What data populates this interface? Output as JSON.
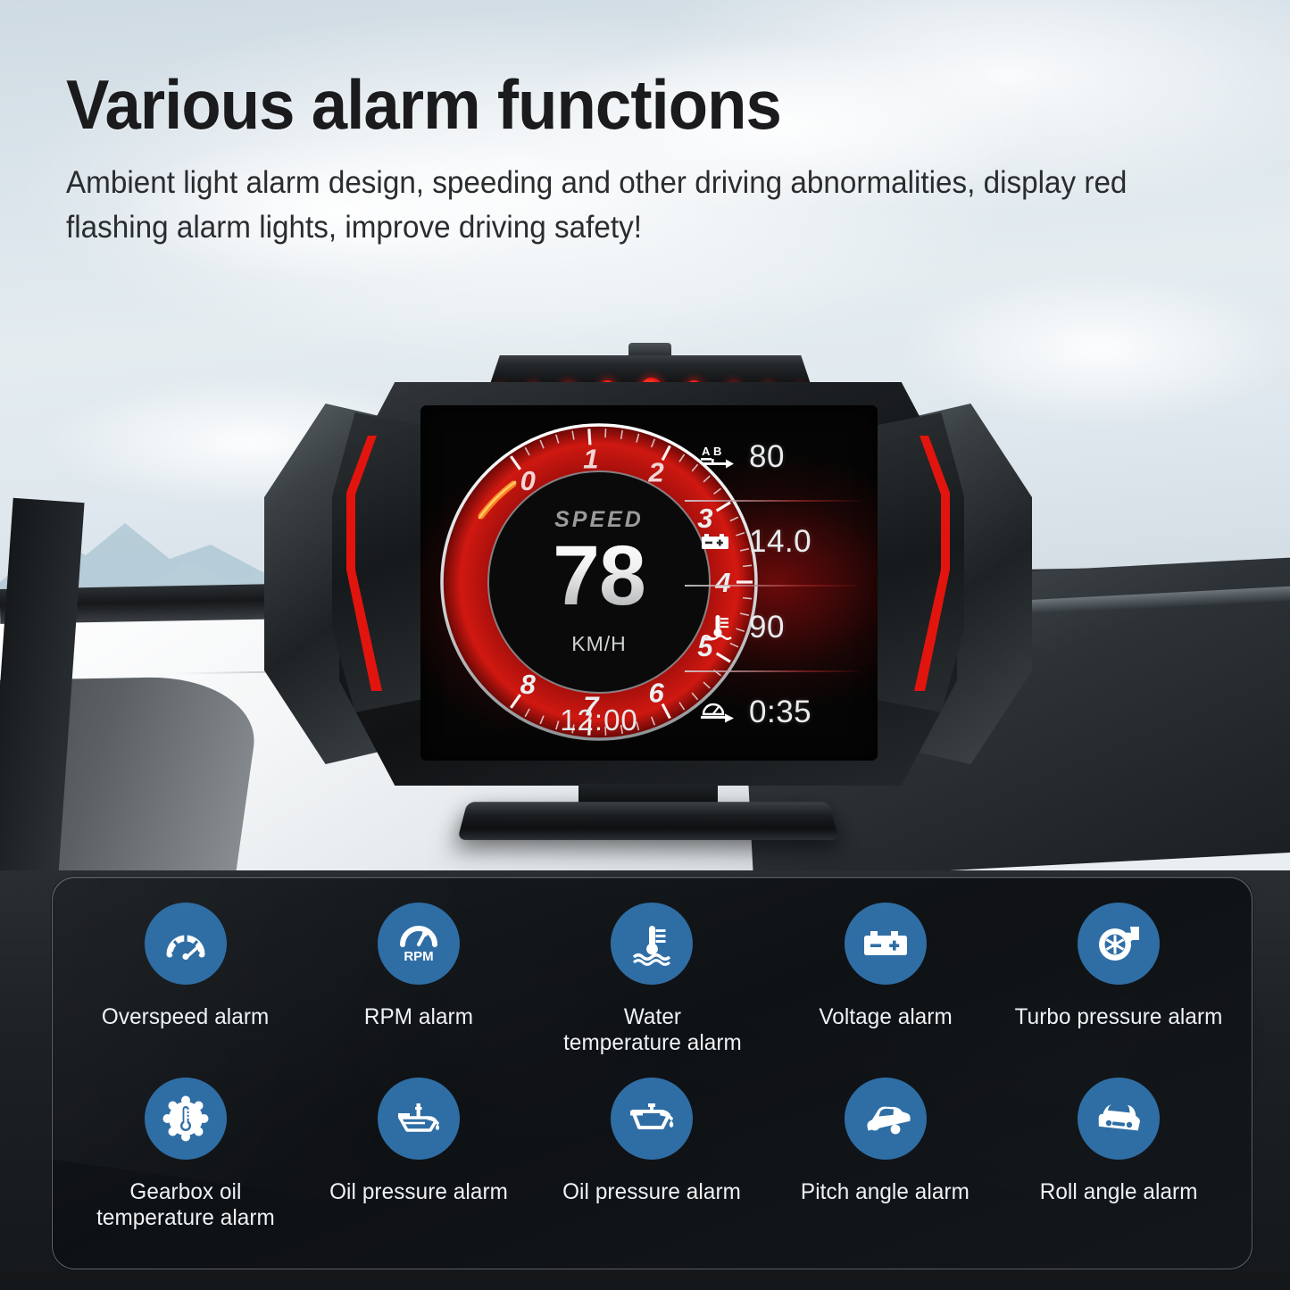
{
  "header": {
    "title": "Various alarm functions",
    "subtitle": "Ambient light alarm design, speeding and other driving abnormalities, display red flashing alarm lights, improve driving safety!"
  },
  "colors": {
    "accent_blue": "#2f6ea5",
    "alarm_red": "#e6140e",
    "bezel_black": "#1c1f22",
    "panel_dark": "#12161a",
    "title_text": "#1b1b1d"
  },
  "device": {
    "name": "heads-up-display",
    "led_count": 9,
    "led_color": "#f21b12",
    "screen": {
      "speed_label": "SPEED",
      "speed_value": "78",
      "speed_unit": "KM/H",
      "clock": "12:00",
      "tach_numbers": [
        "0",
        "1",
        "2",
        "3",
        "4",
        "5",
        "6",
        "7",
        "8"
      ],
      "readouts": [
        {
          "icon": "trip-ab-icon",
          "label": "AB",
          "value": "80"
        },
        {
          "icon": "battery-icon",
          "label": "",
          "value": "14.0"
        },
        {
          "icon": "water-temp-icon",
          "label": "",
          "value": "90"
        },
        {
          "icon": "drive-time-icon",
          "label": "",
          "value": "0:35"
        }
      ]
    }
  },
  "alarms": {
    "items": [
      {
        "icon": "speedometer-icon",
        "label": "Overspeed alarm"
      },
      {
        "icon": "rpm-gauge-icon",
        "label": "RPM alarm"
      },
      {
        "icon": "water-temperature-icon",
        "label": "Water\ntemperature alarm"
      },
      {
        "icon": "battery-icon",
        "label": "Voltage alarm"
      },
      {
        "icon": "turbocharger-icon",
        "label": "Turbo pressure alarm"
      },
      {
        "icon": "gearbox-oil-temp-icon",
        "label": "Gearbox oil\ntemperature alarm"
      },
      {
        "icon": "oil-level-can-icon",
        "label": "Oil pressure alarm"
      },
      {
        "icon": "oil-can-icon",
        "label": "Oil pressure alarm"
      },
      {
        "icon": "car-pitch-icon",
        "label": "Pitch angle alarm"
      },
      {
        "icon": "car-roll-icon",
        "label": "Roll angle alarm"
      }
    ]
  }
}
